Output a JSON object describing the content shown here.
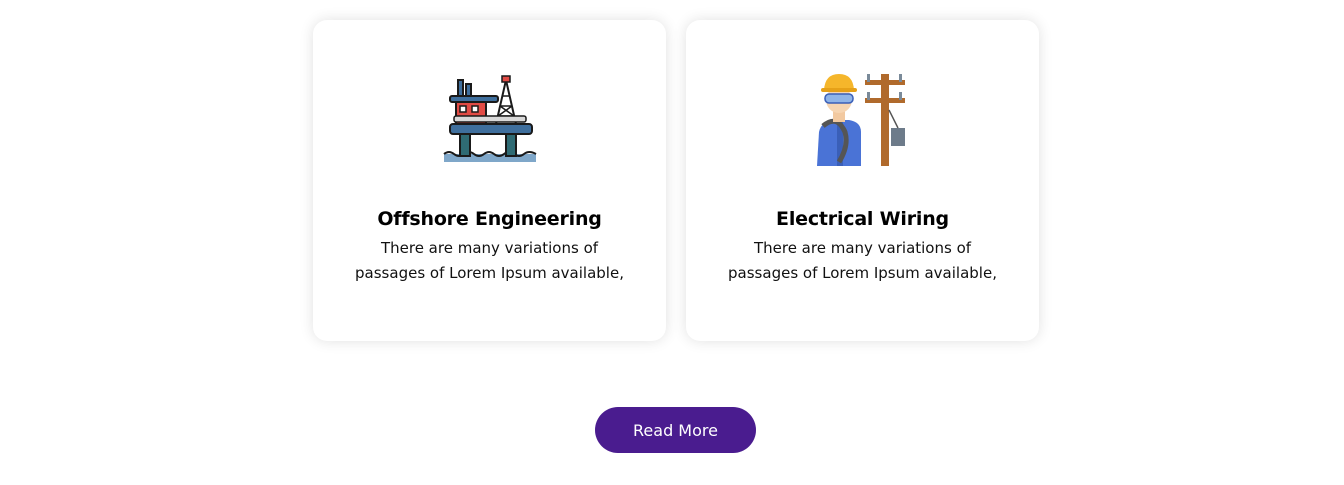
{
  "cards": [
    {
      "icon": "offshore-platform-icon",
      "title": "Offshore Engineering",
      "description_line1": "There are many variations of",
      "description_line2": "passages of Lorem Ipsum available,"
    },
    {
      "icon": "electrician-pole-icon",
      "title": "Electrical Wiring",
      "description_line1": "There are many variations of",
      "description_line2": "passages of Lorem Ipsum available,"
    }
  ],
  "cta": {
    "label": "Read More"
  },
  "colors": {
    "button_background": "#4a1c8f",
    "button_text": "#ffffff",
    "card_background": "#ffffff"
  }
}
